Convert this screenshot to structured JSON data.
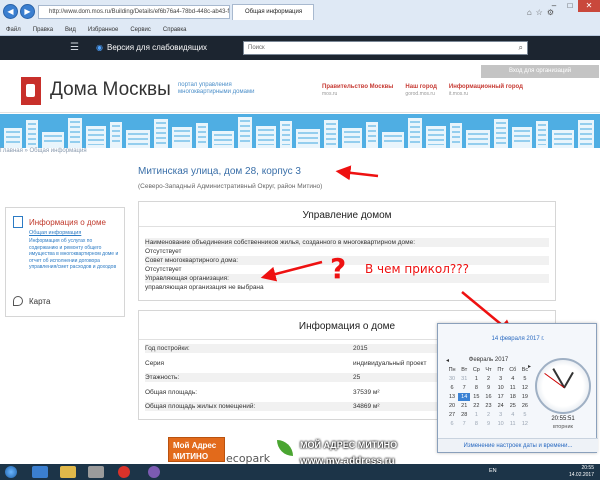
{
  "browser": {
    "url": "http://www.dom.mos.ru/Building/Details/ef6b76a4-78bd-448c-ab43-f13",
    "tab_title": "Общая информация",
    "menu": [
      "Файл",
      "Правка",
      "Вид",
      "Избранное",
      "Сервис",
      "Справка"
    ]
  },
  "topbar": {
    "accessibility_label": "Версия для слабовидящих",
    "search_placeholder": "Поиск"
  },
  "header": {
    "login_label": "Вход для организаций",
    "brand": "Дома Москвы",
    "brand_sub": "портал управления многоквартирными домами",
    "portals": [
      {
        "label": "Правительство Москвы",
        "sub": "mos.ru"
      },
      {
        "label": "Наш город",
        "sub": "gorod.mos.ru"
      },
      {
        "label": "Информационный город",
        "sub": "it.mos.ru"
      }
    ]
  },
  "breadcrumbs": "Главная » Общая информация",
  "building": {
    "title": "Митинская улица, дом 28, корпус 3",
    "subtitle": "(Северо-Западный Административный Округ, район Митино)"
  },
  "sidebar": {
    "heading": "Информация о доме",
    "sub": "Общая информация",
    "description": "Информация об услугах по содержанию и ремонту общего имущества в многоквартирном доме и отчет об исполнении договора управления/смет расходов и доходов",
    "map": "Карта"
  },
  "management": {
    "title": "Управление домом",
    "rows": [
      "Наименование объединения собственников жилья, созданного в многоквартирном доме:",
      "Отсутствует",
      "Совет многоквартирного дома:",
      "Отсутствует",
      "Управляющая организация:",
      "управляющая организация не выбрана"
    ]
  },
  "info": {
    "title": "Информация о доме",
    "rows": [
      {
        "label": "Год постройки:",
        "value": "2015"
      },
      {
        "label": "Серия",
        "value": "индивидуальный проект"
      },
      {
        "label": "Этажность:",
        "value": "25"
      },
      {
        "label": "Общая площадь:",
        "value": "37539 м²"
      },
      {
        "label": "Общая площадь жилых помещений:",
        "value": "34869 м²"
      }
    ]
  },
  "annotation": {
    "question": "?",
    "text": "В чем прикол???"
  },
  "calendar": {
    "date_long": "14 февраля 2017 г.",
    "month": "Февраль 2017",
    "weekdays": [
      "Пн",
      "Вт",
      "Ср",
      "Чт",
      "Пт",
      "Сб",
      "Вс"
    ],
    "days": [
      "30",
      "31",
      "1",
      "2",
      "3",
      "4",
      "5",
      "6",
      "7",
      "8",
      "9",
      "10",
      "11",
      "12",
      "13",
      "14",
      "15",
      "16",
      "17",
      "18",
      "19",
      "20",
      "21",
      "22",
      "23",
      "24",
      "25",
      "26",
      "27",
      "28",
      "1",
      "2",
      "3",
      "4",
      "5",
      "6",
      "7",
      "8",
      "9",
      "10",
      "11",
      "12"
    ],
    "time": "20:55:51",
    "weekday_name": "вторник",
    "settings_link": "Изменение настроек даты и времени..."
  },
  "watermark": {
    "box_line1": "Мой Адрес",
    "box_line2": "МИТИНО",
    "logo": "ecopark",
    "title": "МОЙ АДРЕС МИТИНО",
    "url": "www.my-address.ru"
  },
  "taskbar": {
    "lang": "EN",
    "time": "20:55",
    "date": "14.02.2017"
  }
}
